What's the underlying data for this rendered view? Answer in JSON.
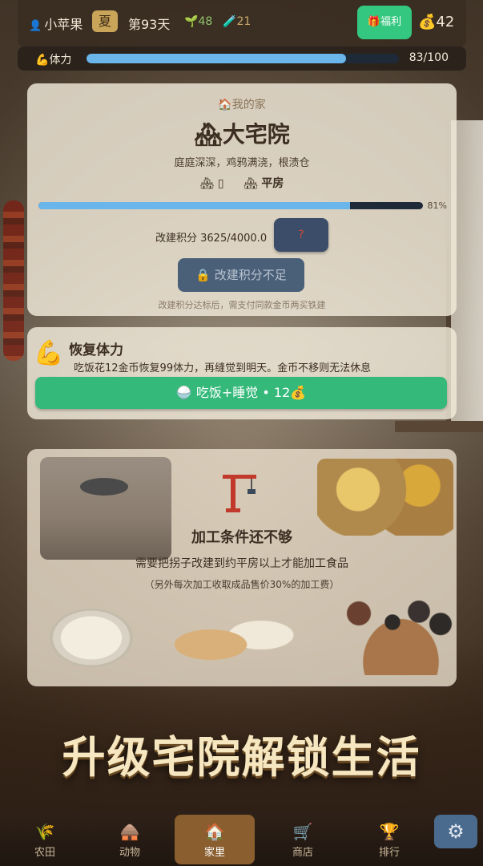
{
  "topbar": {
    "player_name": "小苹果",
    "season": "夏",
    "day": "第93天",
    "seeds": "48",
    "tools": "21",
    "welfare_label": "福利",
    "coins": "42"
  },
  "stamina": {
    "label": "体力",
    "value": 83,
    "max": 100,
    "text": "83/100"
  },
  "home": {
    "section": "我的家",
    "title": "大宅院",
    "description": "庭庭深深，鸡鸦满浇，根渍仓",
    "level_current": "▯",
    "level_next": "平房",
    "progress": 0.81,
    "progress_text": "81%",
    "points_text": "改建积分 3625/4000.0",
    "question_label": "?",
    "upgrade_label": "改建积分不足",
    "note": "改建积分达标后，需支付同款金币两买铁建"
  },
  "restore": {
    "title": "恢复体力",
    "description": "吃饭花12金币恢复99体力，再缝觉到明天。金币不移则无法休息",
    "button_label": "吃饭+睡觉",
    "button_cost": "12"
  },
  "process": {
    "title": "加工条件还不够",
    "description": "需要把拐子改建到约平房以上才能加工食品",
    "note": "（另外每次加工收取成品售价30%的加工费）"
  },
  "promo": "升级宅院解锁生活",
  "nav": [
    {
      "label": "农田",
      "icon": "wheat-icon"
    },
    {
      "label": "动物",
      "icon": "barn-icon"
    },
    {
      "label": "家里",
      "icon": "house-icon"
    },
    {
      "label": "商店",
      "icon": "cart-icon"
    },
    {
      "label": "排行",
      "icon": "trophy-icon"
    }
  ],
  "colors": {
    "accent_green": "#34b97a",
    "progress_blue": "#6ab6ea",
    "nav_active": "#8a5e2e"
  }
}
